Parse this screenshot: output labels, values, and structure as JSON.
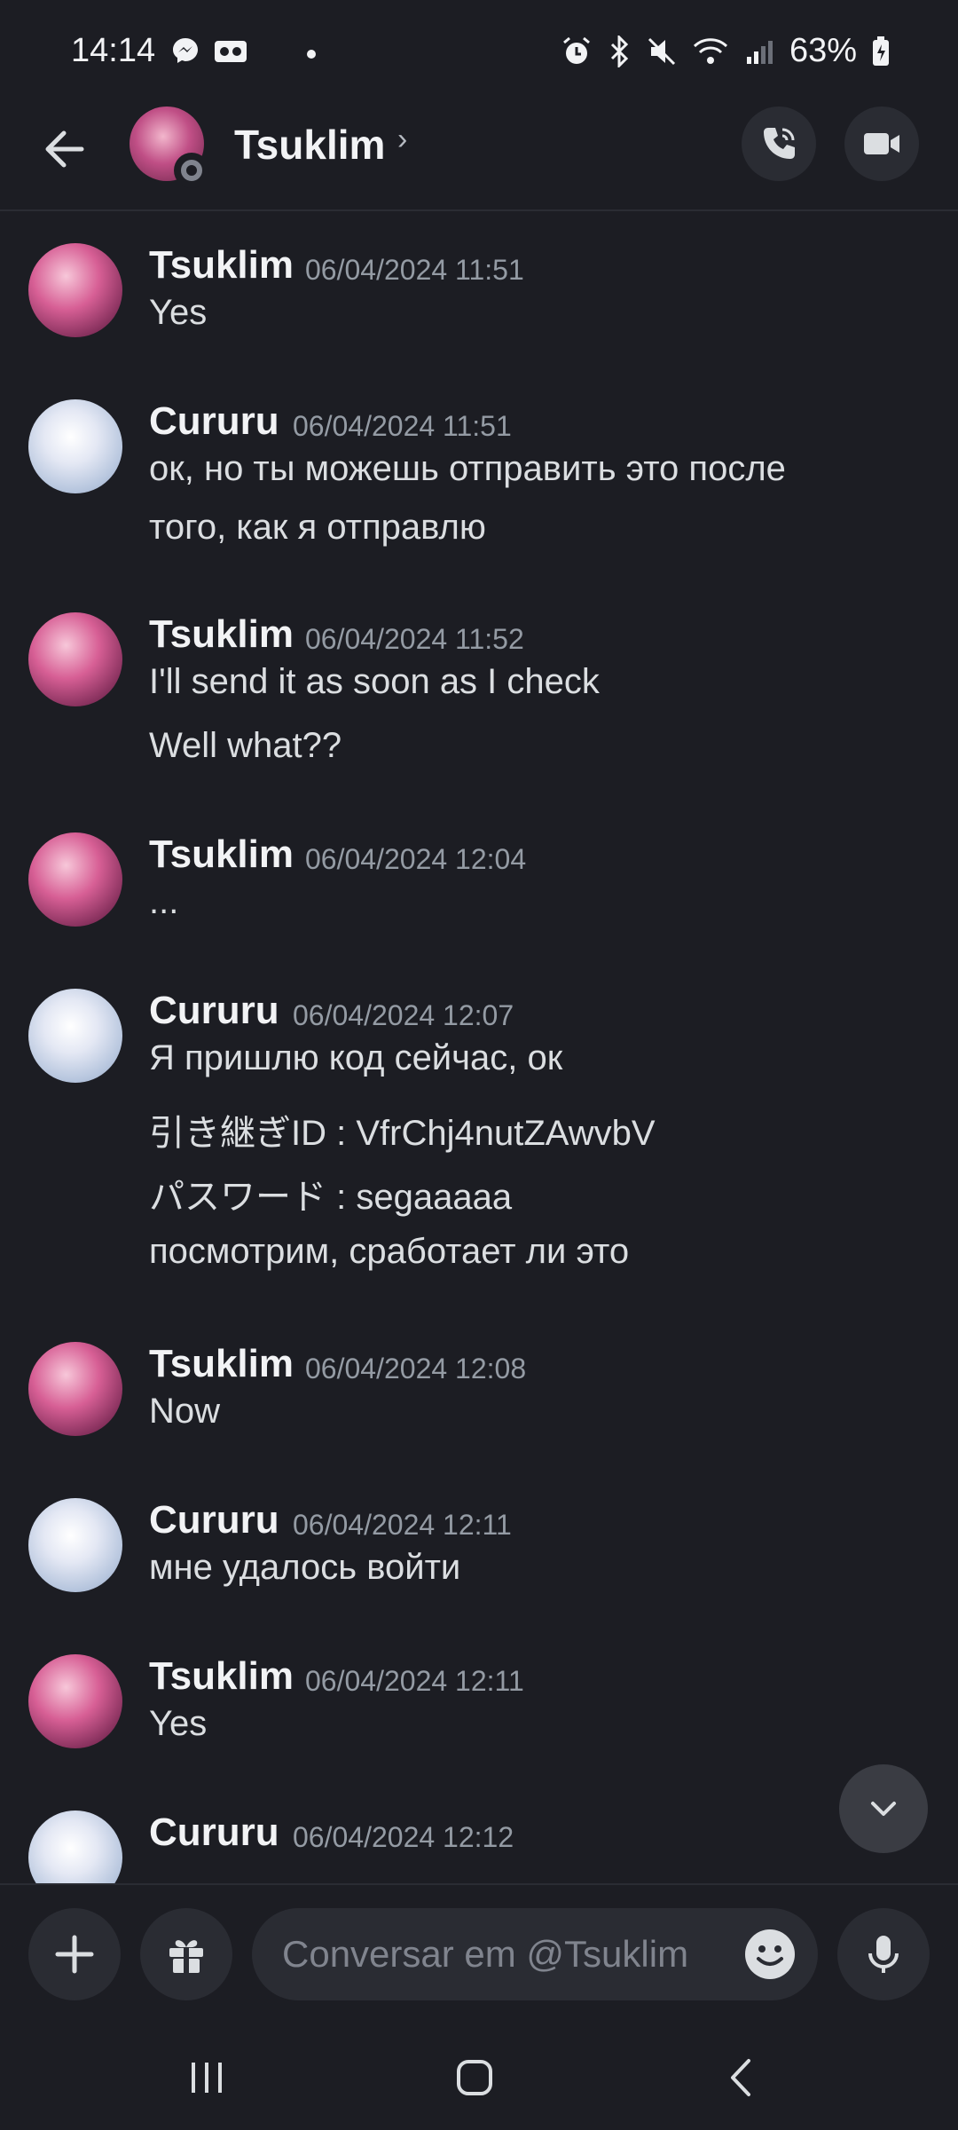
{
  "status_bar": {
    "time": "14:14",
    "battery": "63%"
  },
  "header": {
    "contact_name": "Tsuklim",
    "chevron": "›"
  },
  "messages": [
    {
      "author": "Tsuklim",
      "time": "06/04/2024 11:51",
      "lines": [
        "Yes"
      ]
    },
    {
      "author": "Cururu",
      "time": "06/04/2024 11:51",
      "lines": [
        "ок, но ты можешь отправить это после",
        "того, как я отправлю"
      ]
    },
    {
      "author": "Tsuklim",
      "time": "06/04/2024 11:52",
      "lines": [
        "I'll send it as soon as I check",
        "Well what??"
      ]
    },
    {
      "author": "Tsuklim",
      "time": "06/04/2024 12:04",
      "lines": [
        "..."
      ]
    },
    {
      "author": "Cururu",
      "time": "06/04/2024 12:07",
      "lines": [
        "Я пришлю код сейчас, ок",
        "引き継ぎID : VfrChj4nutZAwvbV",
        "パスワード : segaaaaa",
        "посмотрим, сработает ли это"
      ]
    },
    {
      "author": "Tsuklim",
      "time": "06/04/2024 12:08",
      "lines": [
        "Now"
      ]
    },
    {
      "author": "Cururu",
      "time": "06/04/2024 12:11",
      "lines": [
        "мне удалось войти"
      ]
    },
    {
      "author": "Tsuklim",
      "time": "06/04/2024 12:11",
      "lines": [
        "Yes"
      ]
    },
    {
      "author": "Cururu",
      "time": "06/04/2024 12:12",
      "lines": []
    }
  ],
  "composer": {
    "placeholder": "Conversar em @Tsuklim"
  },
  "icons": {
    "back": "back-arrow-icon",
    "call": "phone-call-icon",
    "video": "video-camera-icon",
    "add": "plus-icon",
    "gift": "gift-icon",
    "emoji": "emoji-icon",
    "mic": "microphone-icon",
    "scroll": "chevron-down-icon"
  },
  "colors": {
    "background": "#1c1d23",
    "surface": "#2a2c33",
    "text": "#dbdee1",
    "muted": "#949ba4"
  }
}
